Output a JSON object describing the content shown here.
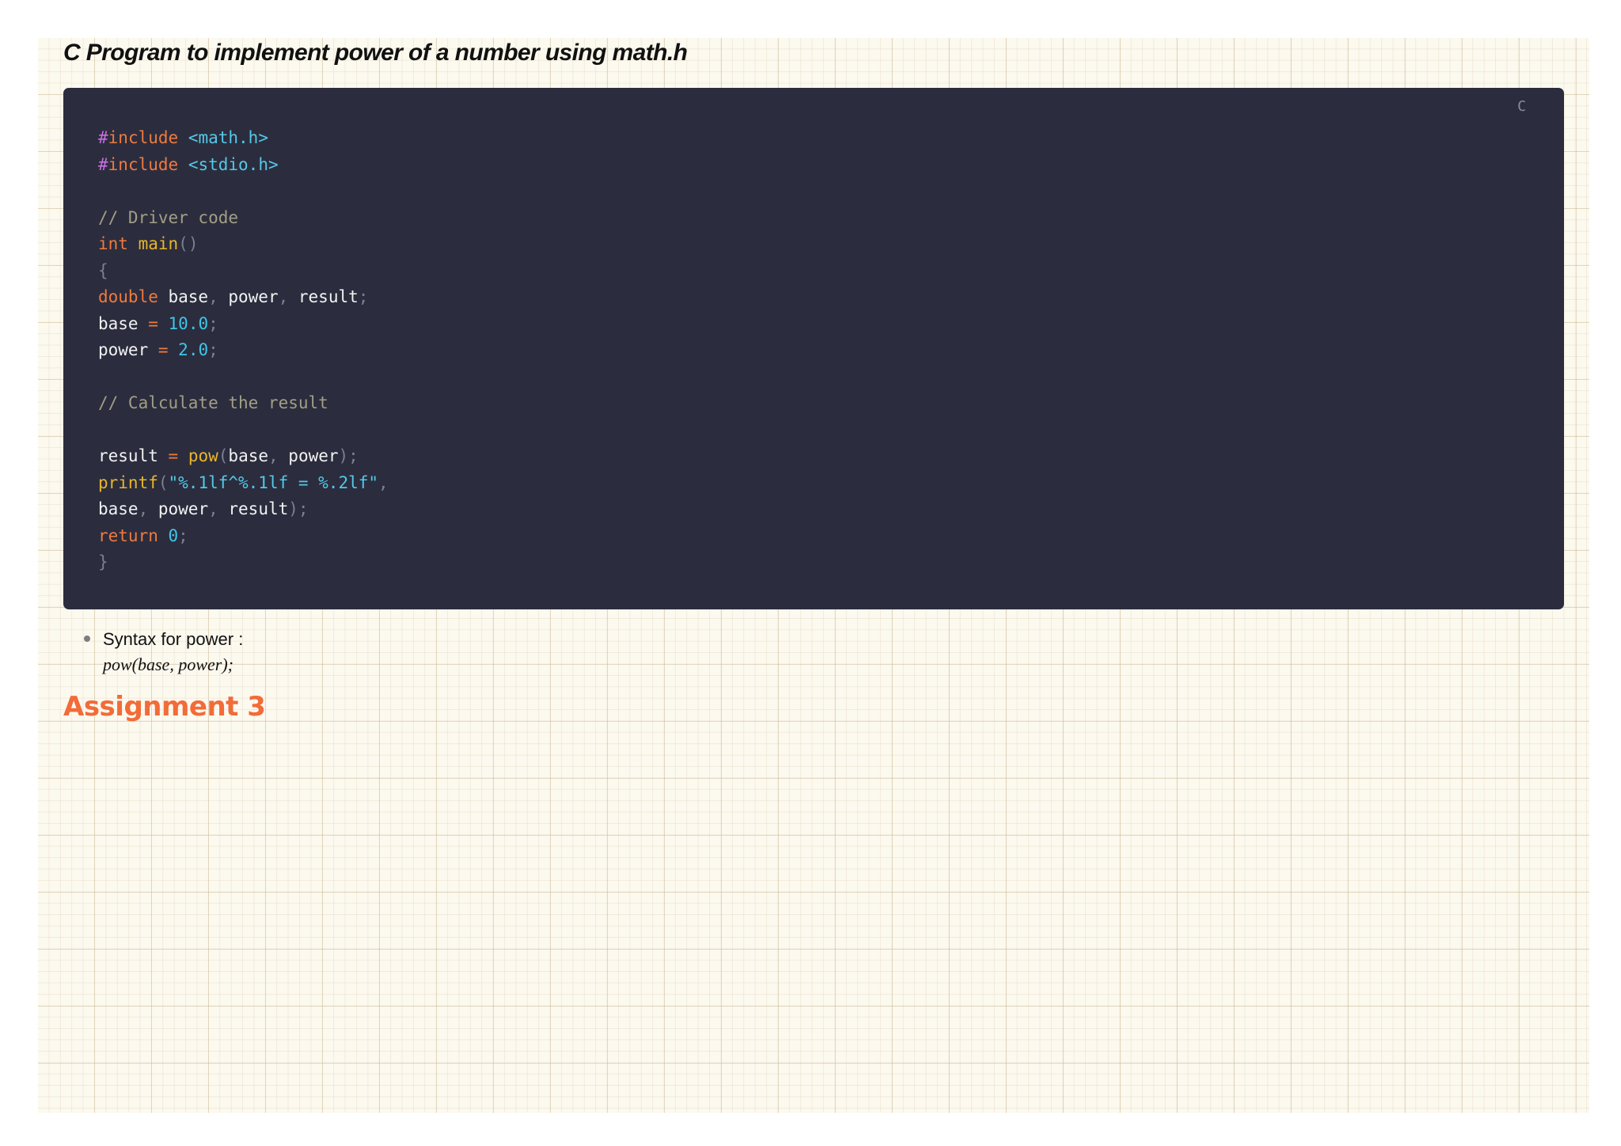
{
  "document": {
    "title": "C Program to implement power of a number using math.h"
  },
  "code_block": {
    "language": "C",
    "lines": [
      [
        {
          "t": "#",
          "c": "pre"
        },
        {
          "t": "include",
          "c": "kw"
        },
        {
          "t": " ",
          "c": "txt"
        },
        {
          "t": "<math.h>",
          "c": "str"
        }
      ],
      [
        {
          "t": "#",
          "c": "pre"
        },
        {
          "t": "include",
          "c": "kw"
        },
        {
          "t": " ",
          "c": "txt"
        },
        {
          "t": "<stdio.h>",
          "c": "str"
        }
      ],
      [],
      [
        {
          "t": "// Driver code",
          "c": "com"
        }
      ],
      [
        {
          "t": "int",
          "c": "kw"
        },
        {
          "t": " ",
          "c": "txt"
        },
        {
          "t": "main",
          "c": "fn"
        },
        {
          "t": "()",
          "c": "pun"
        }
      ],
      [
        {
          "t": "{",
          "c": "pun"
        }
      ],
      [
        {
          "t": "double",
          "c": "kw"
        },
        {
          "t": " base",
          "c": "txt"
        },
        {
          "t": ",",
          "c": "pun"
        },
        {
          "t": " power",
          "c": "txt"
        },
        {
          "t": ",",
          "c": "pun"
        },
        {
          "t": " result",
          "c": "txt"
        },
        {
          "t": ";",
          "c": "pun"
        }
      ],
      [
        {
          "t": "base ",
          "c": "txt"
        },
        {
          "t": "=",
          "c": "op"
        },
        {
          "t": " ",
          "c": "txt"
        },
        {
          "t": "10.0",
          "c": "num"
        },
        {
          "t": ";",
          "c": "pun"
        }
      ],
      [
        {
          "t": "power ",
          "c": "txt"
        },
        {
          "t": "=",
          "c": "op"
        },
        {
          "t": " ",
          "c": "txt"
        },
        {
          "t": "2.0",
          "c": "num"
        },
        {
          "t": ";",
          "c": "pun"
        }
      ],
      [],
      [
        {
          "t": "// Calculate the result",
          "c": "com"
        }
      ],
      [],
      [
        {
          "t": "result ",
          "c": "txt"
        },
        {
          "t": "=",
          "c": "op"
        },
        {
          "t": " ",
          "c": "txt"
        },
        {
          "t": "pow",
          "c": "fn"
        },
        {
          "t": "(",
          "c": "pun"
        },
        {
          "t": "base",
          "c": "txt"
        },
        {
          "t": ",",
          "c": "pun"
        },
        {
          "t": " power",
          "c": "txt"
        },
        {
          "t": ");",
          "c": "pun"
        }
      ],
      [
        {
          "t": "printf",
          "c": "fn"
        },
        {
          "t": "(",
          "c": "pun"
        },
        {
          "t": "\"%.1lf^%.1lf = %.2lf\"",
          "c": "str"
        },
        {
          "t": ",",
          "c": "pun"
        }
      ],
      [
        {
          "t": "base",
          "c": "txt"
        },
        {
          "t": ",",
          "c": "pun"
        },
        {
          "t": " power",
          "c": "txt"
        },
        {
          "t": ",",
          "c": "pun"
        },
        {
          "t": " result",
          "c": "txt"
        },
        {
          "t": ");",
          "c": "pun"
        }
      ],
      [
        {
          "t": "return",
          "c": "kw"
        },
        {
          "t": " ",
          "c": "txt"
        },
        {
          "t": "0",
          "c": "num"
        },
        {
          "t": ";",
          "c": "pun"
        }
      ],
      [
        {
          "t": "}",
          "c": "pun"
        }
      ]
    ]
  },
  "notes": {
    "items": [
      {
        "text": "Syntax for power :",
        "formula": "pow(base, power);"
      }
    ]
  },
  "section": {
    "heading": "Assignment 3"
  },
  "colors": {
    "code_background": "#2b2d3e",
    "heading_accent": "#f26b38",
    "paper": "#fcf9ef"
  }
}
